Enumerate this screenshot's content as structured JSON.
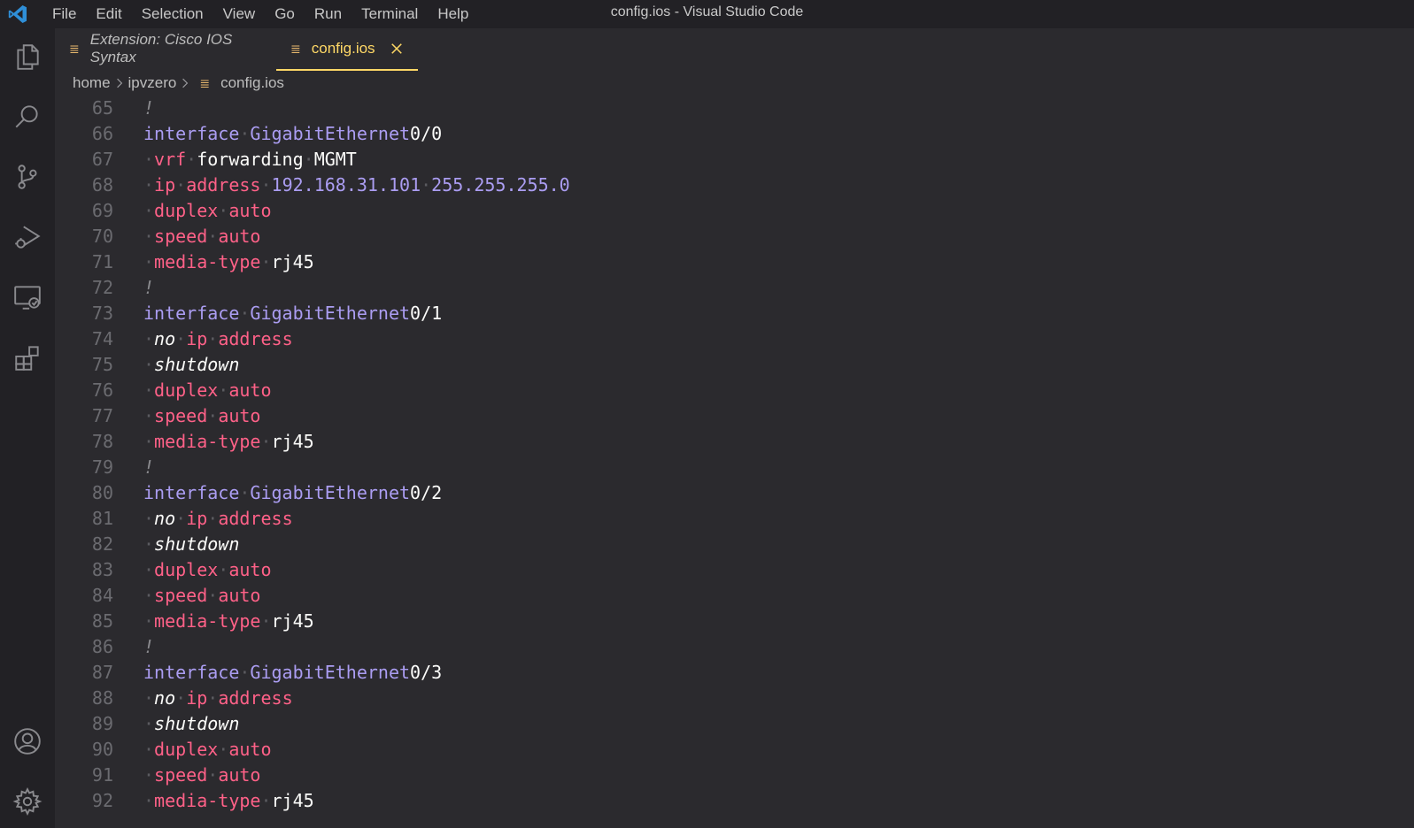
{
  "window": {
    "title": "config.ios - Visual Studio Code"
  },
  "menu": [
    "File",
    "Edit",
    "Selection",
    "View",
    "Go",
    "Run",
    "Terminal",
    "Help"
  ],
  "colors": {
    "accent": "#ffd866",
    "keyword": "#ff6188",
    "interface": "#ab9df2",
    "background": "#2b2a2e",
    "chrome": "#222125"
  },
  "activity_bar": {
    "top": [
      "files-icon",
      "search-icon",
      "source-control-icon",
      "run-debug-icon",
      "remote-explorer-icon",
      "extensions-icon"
    ],
    "bottom": [
      "account-icon",
      "settings-gear-icon"
    ]
  },
  "tabs": [
    {
      "label": "Extension: Cisco IOS Syntax",
      "active": false
    },
    {
      "label": "config.ios",
      "active": true
    }
  ],
  "breadcrumb": {
    "parts": [
      "home",
      "ipvzero"
    ],
    "file": "config.ios"
  },
  "editor": {
    "lines": [
      {
        "n": "65",
        "tokens": [
          {
            "t": "!",
            "c": "comment"
          }
        ]
      },
      {
        "n": "66",
        "tokens": [
          {
            "t": "interface",
            "c": "iface"
          },
          {
            "t": "·",
            "c": "ws"
          },
          {
            "t": "GigabitEthernet",
            "c": "iface"
          },
          {
            "t": "0/0",
            "c": "plain"
          }
        ]
      },
      {
        "n": "67",
        "tokens": [
          {
            "t": "·",
            "c": "ws"
          },
          {
            "t": "vrf",
            "c": "kw"
          },
          {
            "t": "·",
            "c": "ws"
          },
          {
            "t": "forwarding",
            "c": "plain"
          },
          {
            "t": "·",
            "c": "ws"
          },
          {
            "t": "MGMT",
            "c": "plain"
          }
        ]
      },
      {
        "n": "68",
        "tokens": [
          {
            "t": "·",
            "c": "ws"
          },
          {
            "t": "ip",
            "c": "kw"
          },
          {
            "t": "·",
            "c": "ws"
          },
          {
            "t": "address",
            "c": "kw"
          },
          {
            "t": "·",
            "c": "ws"
          },
          {
            "t": "192.168.31.101",
            "c": "num"
          },
          {
            "t": "·",
            "c": "ws"
          },
          {
            "t": "255.255.255.0",
            "c": "num"
          }
        ]
      },
      {
        "n": "69",
        "tokens": [
          {
            "t": "·",
            "c": "ws"
          },
          {
            "t": "duplex",
            "c": "kw"
          },
          {
            "t": "·",
            "c": "ws"
          },
          {
            "t": "auto",
            "c": "kw"
          }
        ]
      },
      {
        "n": "70",
        "tokens": [
          {
            "t": "·",
            "c": "ws"
          },
          {
            "t": "speed",
            "c": "kw"
          },
          {
            "t": "·",
            "c": "ws"
          },
          {
            "t": "auto",
            "c": "kw"
          }
        ]
      },
      {
        "n": "71",
        "tokens": [
          {
            "t": "·",
            "c": "ws"
          },
          {
            "t": "media-type",
            "c": "kw"
          },
          {
            "t": "·",
            "c": "ws"
          },
          {
            "t": "rj45",
            "c": "plain"
          }
        ]
      },
      {
        "n": "72",
        "tokens": [
          {
            "t": "!",
            "c": "comment"
          }
        ]
      },
      {
        "n": "73",
        "tokens": [
          {
            "t": "interface",
            "c": "iface"
          },
          {
            "t": "·",
            "c": "ws"
          },
          {
            "t": "GigabitEthernet",
            "c": "iface"
          },
          {
            "t": "0/1",
            "c": "plain"
          }
        ]
      },
      {
        "n": "74",
        "tokens": [
          {
            "t": "·",
            "c": "ws"
          },
          {
            "t": "no",
            "c": "neg"
          },
          {
            "t": "·",
            "c": "ws"
          },
          {
            "t": "ip",
            "c": "kw"
          },
          {
            "t": "·",
            "c": "ws"
          },
          {
            "t": "address",
            "c": "kw"
          }
        ]
      },
      {
        "n": "75",
        "tokens": [
          {
            "t": "·",
            "c": "ws"
          },
          {
            "t": "shutdown",
            "c": "neg"
          }
        ]
      },
      {
        "n": "76",
        "tokens": [
          {
            "t": "·",
            "c": "ws"
          },
          {
            "t": "duplex",
            "c": "kw"
          },
          {
            "t": "·",
            "c": "ws"
          },
          {
            "t": "auto",
            "c": "kw"
          }
        ]
      },
      {
        "n": "77",
        "tokens": [
          {
            "t": "·",
            "c": "ws"
          },
          {
            "t": "speed",
            "c": "kw"
          },
          {
            "t": "·",
            "c": "ws"
          },
          {
            "t": "auto",
            "c": "kw"
          }
        ]
      },
      {
        "n": "78",
        "tokens": [
          {
            "t": "·",
            "c": "ws"
          },
          {
            "t": "media-type",
            "c": "kw"
          },
          {
            "t": "·",
            "c": "ws"
          },
          {
            "t": "rj45",
            "c": "plain"
          }
        ]
      },
      {
        "n": "79",
        "tokens": [
          {
            "t": "!",
            "c": "comment"
          }
        ]
      },
      {
        "n": "80",
        "tokens": [
          {
            "t": "interface",
            "c": "iface"
          },
          {
            "t": "·",
            "c": "ws"
          },
          {
            "t": "GigabitEthernet",
            "c": "iface"
          },
          {
            "t": "0/2",
            "c": "plain"
          }
        ]
      },
      {
        "n": "81",
        "tokens": [
          {
            "t": "·",
            "c": "ws"
          },
          {
            "t": "no",
            "c": "neg"
          },
          {
            "t": "·",
            "c": "ws"
          },
          {
            "t": "ip",
            "c": "kw"
          },
          {
            "t": "·",
            "c": "ws"
          },
          {
            "t": "address",
            "c": "kw"
          }
        ]
      },
      {
        "n": "82",
        "tokens": [
          {
            "t": "·",
            "c": "ws"
          },
          {
            "t": "shutdown",
            "c": "neg"
          }
        ]
      },
      {
        "n": "83",
        "tokens": [
          {
            "t": "·",
            "c": "ws"
          },
          {
            "t": "duplex",
            "c": "kw"
          },
          {
            "t": "·",
            "c": "ws"
          },
          {
            "t": "auto",
            "c": "kw"
          }
        ]
      },
      {
        "n": "84",
        "tokens": [
          {
            "t": "·",
            "c": "ws"
          },
          {
            "t": "speed",
            "c": "kw"
          },
          {
            "t": "·",
            "c": "ws"
          },
          {
            "t": "auto",
            "c": "kw"
          }
        ]
      },
      {
        "n": "85",
        "tokens": [
          {
            "t": "·",
            "c": "ws"
          },
          {
            "t": "media-type",
            "c": "kw"
          },
          {
            "t": "·",
            "c": "ws"
          },
          {
            "t": "rj45",
            "c": "plain"
          }
        ]
      },
      {
        "n": "86",
        "tokens": [
          {
            "t": "!",
            "c": "comment"
          }
        ]
      },
      {
        "n": "87",
        "tokens": [
          {
            "t": "interface",
            "c": "iface"
          },
          {
            "t": "·",
            "c": "ws"
          },
          {
            "t": "GigabitEthernet",
            "c": "iface"
          },
          {
            "t": "0/3",
            "c": "plain"
          }
        ]
      },
      {
        "n": "88",
        "tokens": [
          {
            "t": "·",
            "c": "ws"
          },
          {
            "t": "no",
            "c": "neg"
          },
          {
            "t": "·",
            "c": "ws"
          },
          {
            "t": "ip",
            "c": "kw"
          },
          {
            "t": "·",
            "c": "ws"
          },
          {
            "t": "address",
            "c": "kw"
          }
        ]
      },
      {
        "n": "89",
        "tokens": [
          {
            "t": "·",
            "c": "ws"
          },
          {
            "t": "shutdown",
            "c": "neg"
          }
        ]
      },
      {
        "n": "90",
        "tokens": [
          {
            "t": "·",
            "c": "ws"
          },
          {
            "t": "duplex",
            "c": "kw"
          },
          {
            "t": "·",
            "c": "ws"
          },
          {
            "t": "auto",
            "c": "kw"
          }
        ]
      },
      {
        "n": "91",
        "tokens": [
          {
            "t": "·",
            "c": "ws"
          },
          {
            "t": "speed",
            "c": "kw"
          },
          {
            "t": "·",
            "c": "ws"
          },
          {
            "t": "auto",
            "c": "kw"
          }
        ]
      },
      {
        "n": "92",
        "tokens": [
          {
            "t": "·",
            "c": "ws"
          },
          {
            "t": "media-type",
            "c": "kw"
          },
          {
            "t": "·",
            "c": "ws"
          },
          {
            "t": "rj45",
            "c": "plain"
          }
        ]
      }
    ]
  }
}
